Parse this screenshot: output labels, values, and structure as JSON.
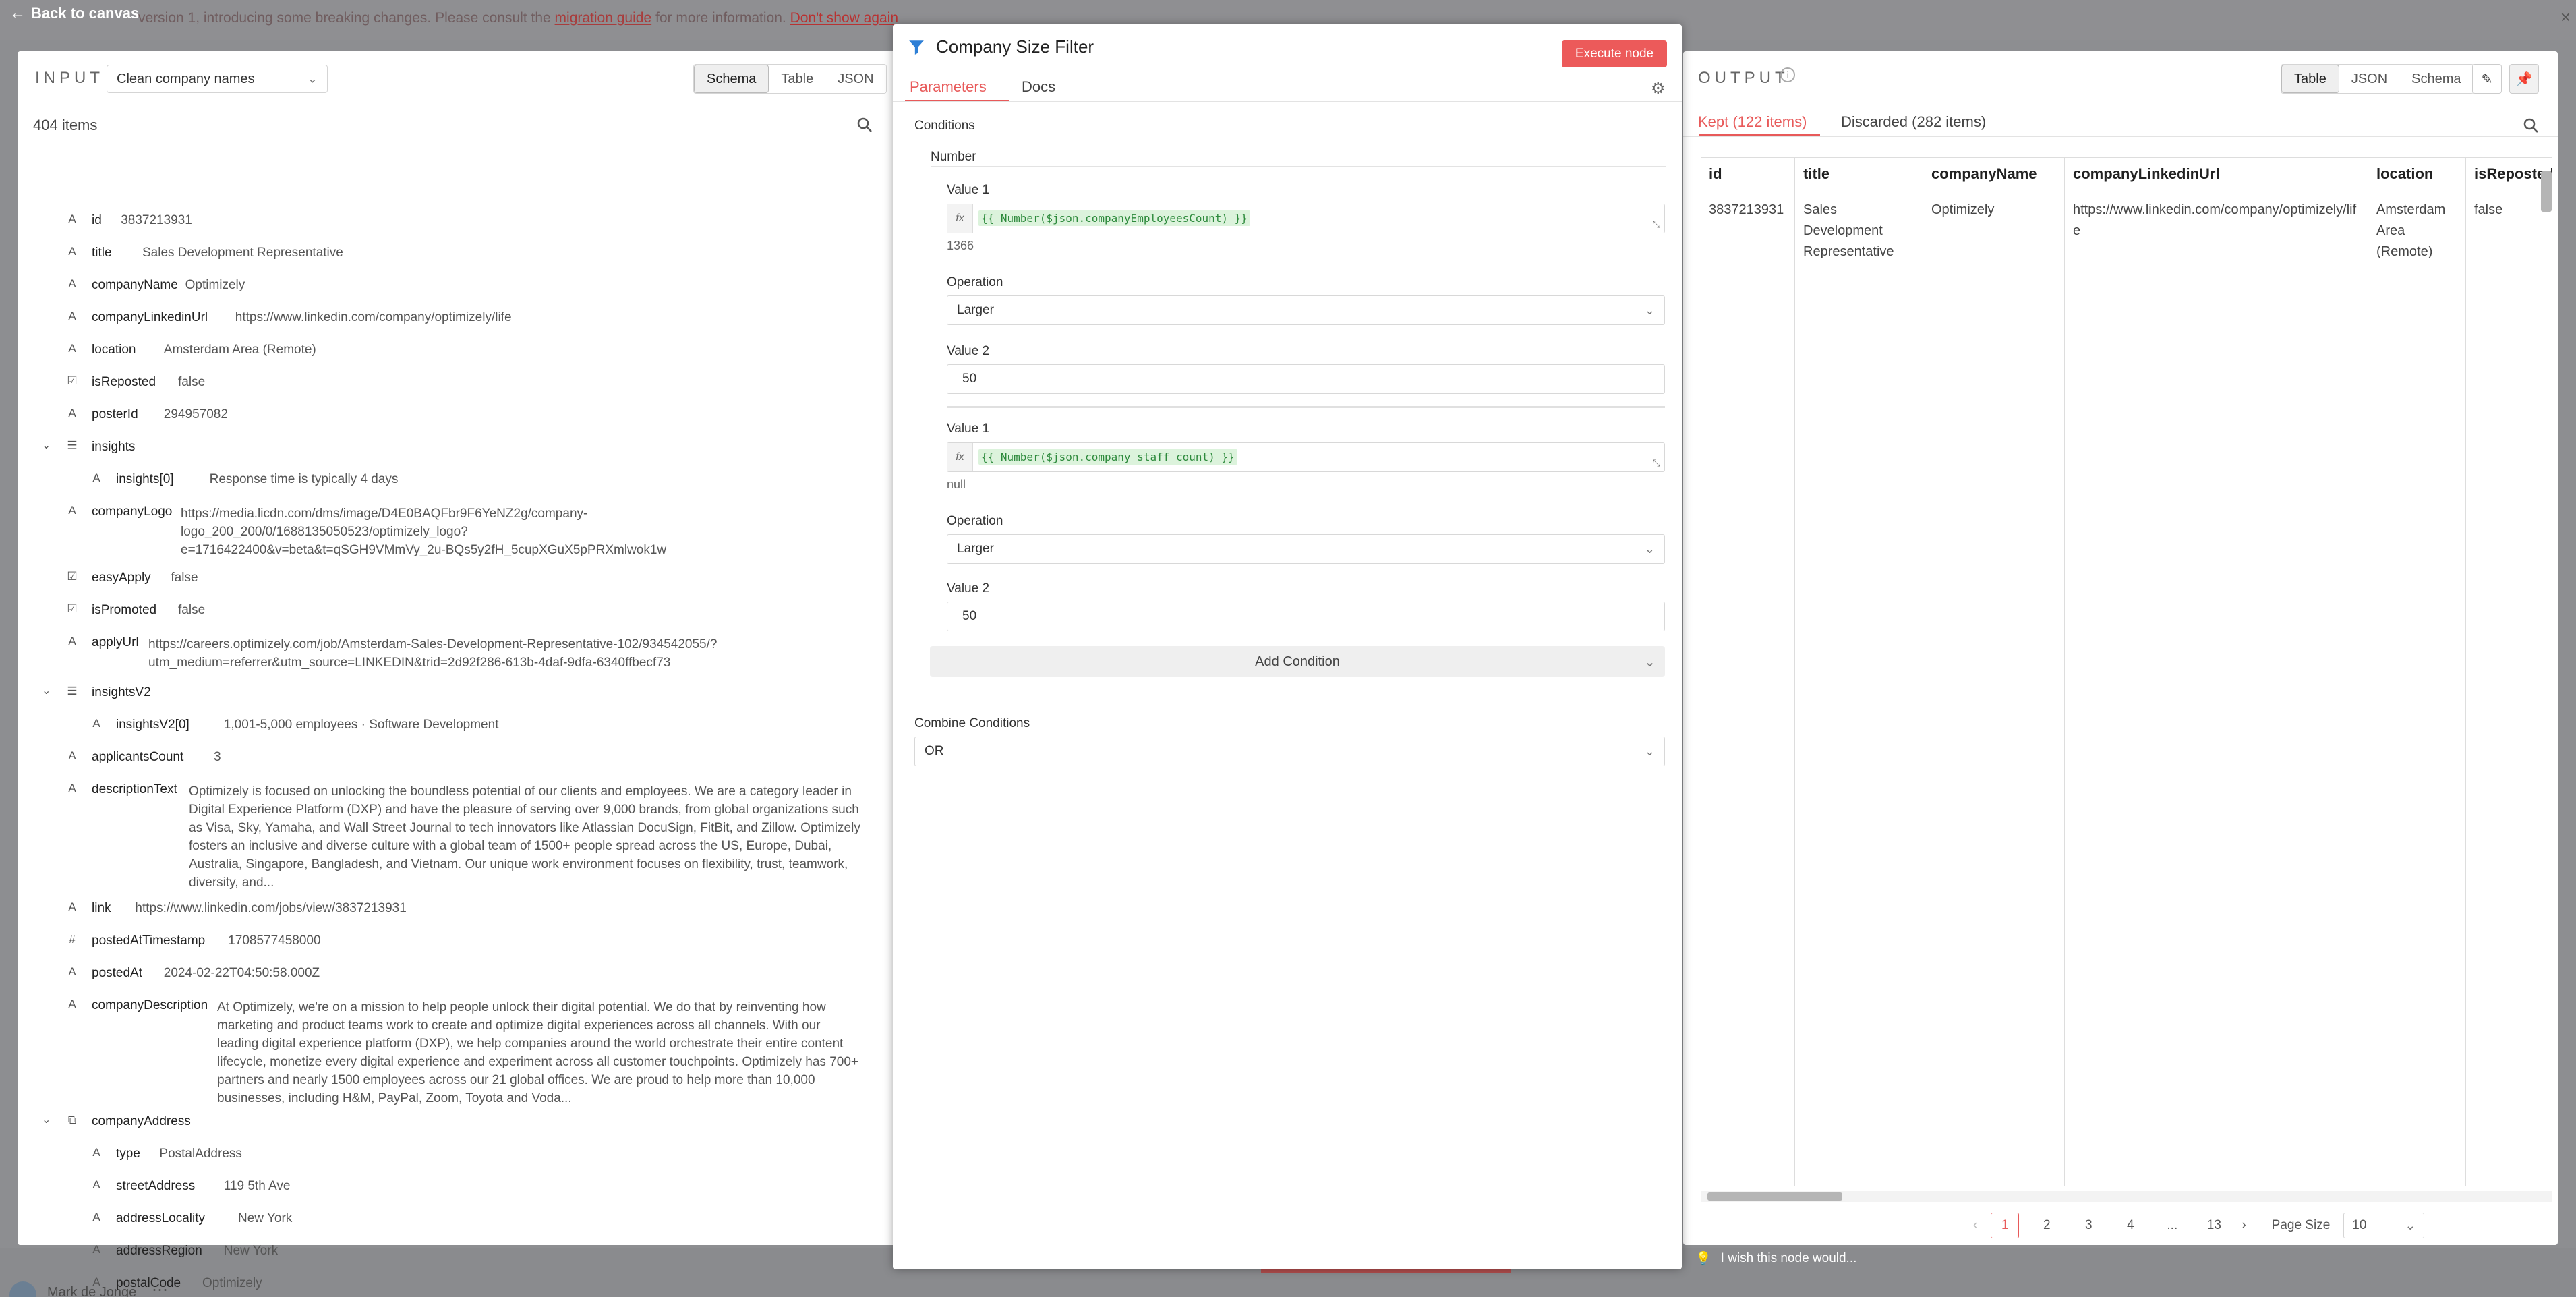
{
  "topbar": {
    "back_label": "Back to canvas",
    "banner_text": "version 1, introducing some breaking changes. Please consult the",
    "banner_link": "migration guide",
    "banner_rest": "for more information.",
    "banner_dismiss": "Don't show again"
  },
  "input": {
    "label": "INPUT",
    "source_node": "Clean company names",
    "view_tabs": [
      "Schema",
      "Table",
      "JSON"
    ],
    "active_view": "Schema",
    "item_count": "404 items",
    "fields": [
      {
        "type": "A",
        "key": "id",
        "value": "3837213931"
      },
      {
        "type": "A",
        "key": "title",
        "value": "Sales Development Representative"
      },
      {
        "type": "A",
        "key": "companyName",
        "value": "Optimizely"
      },
      {
        "type": "A",
        "key": "companyLinkedinUrl",
        "value": "https://www.linkedin.com/company/optimizely/life"
      },
      {
        "type": "A",
        "key": "location",
        "value": "Amsterdam Area (Remote)"
      },
      {
        "type": "bool",
        "key": "isReposted",
        "value": "false"
      },
      {
        "type": "A",
        "key": "posterId",
        "value": "294957082"
      },
      {
        "type": "list",
        "key": "insights",
        "value": ""
      },
      {
        "type": "A",
        "key": "insights[0]",
        "value": "Response time is typically 4 days"
      },
      {
        "type": "A",
        "key": "companyLogo",
        "value": "https://media.licdn.com/dms/image/D4E0BAQFbr9F6YeNZ2g/company-logo_200_200/0/1688135050523/optimizely_logo?e=1716422400&v=beta&t=qSGH9VMmVy_2u-BQs5y2fH_5cupXGuX5pPRXmlwok1w"
      },
      {
        "type": "bool",
        "key": "easyApply",
        "value": "false"
      },
      {
        "type": "bool",
        "key": "isPromoted",
        "value": "false"
      },
      {
        "type": "A",
        "key": "applyUrl",
        "value": "https://careers.optimizely.com/job/Amsterdam-Sales-Development-Representative-102/934542055/?utm_medium=referrer&utm_source=LINKEDIN&trid=2d92f286-613b-4daf-9dfa-6340ffbecf73"
      },
      {
        "type": "list",
        "key": "insightsV2",
        "value": ""
      },
      {
        "type": "A",
        "key": "insightsV2[0]",
        "value": "1,001-5,000 employees · Software Development"
      },
      {
        "type": "A",
        "key": "applicantsCount",
        "value": "3"
      },
      {
        "type": "A",
        "key": "descriptionText",
        "value": "Optimizely is focused on unlocking the boundless potential of our clients and employees. We are a category leader in Digital Experience Platform (DXP) and have the pleasure of serving over 9,000 brands, from global organizations such as Visa, Sky, Yamaha, and Wall Street Journal to tech innovators like Atlassian DocuSign, FitBit, and Zillow. Optimizely fosters an inclusive and diverse culture with a global team of 1500+ people spread across the US, Europe, Dubai, Australia, Singapore, Bangladesh, and Vietnam. Our unique work environment focuses on flexibility, trust, teamwork, diversity, and..."
      },
      {
        "type": "A",
        "key": "link",
        "value": "https://www.linkedin.com/jobs/view/3837213931"
      },
      {
        "type": "#",
        "key": "postedAtTimestamp",
        "value": "1708577458000"
      },
      {
        "type": "A",
        "key": "postedAt",
        "value": "2024-02-22T04:50:58.000Z"
      },
      {
        "type": "A",
        "key": "companyDescription",
        "value": "At Optimizely, we're on a mission to help people unlock their digital potential. We do that by reinventing how marketing and product teams work to create and optimize digital experiences across all channels. With our leading digital experience platform (DXP), we help companies around the world orchestrate their entire content lifecycle, monetize every digital experience and experiment across all customer touchpoints. Optimizely has 700+ partners and nearly 1500 employees across our 21 global offices. We are proud to help more than 10,000 businesses, including H&M, PayPal, Zoom, Toyota and Voda..."
      },
      {
        "type": "obj",
        "key": "companyAddress",
        "value": ""
      },
      {
        "type": "A",
        "key": "type",
        "value": "PostalAddress"
      },
      {
        "type": "A",
        "key": "streetAddress",
        "value": "119 5th Ave"
      },
      {
        "type": "A",
        "key": "addressLocality",
        "value": "New York"
      },
      {
        "type": "A",
        "key": "addressRegion",
        "value": "New York"
      },
      {
        "type": "A",
        "key": "postalCode",
        "value": "Optimizely"
      }
    ]
  },
  "node": {
    "title": "Company Size Filter",
    "execute_label": "Execute node",
    "tabs": [
      "Parameters",
      "Docs"
    ],
    "conditions_label": "Conditions",
    "number_label": "Number",
    "cond1": {
      "value1_label": "Value 1",
      "value1_expr": "{{ Number($json.companyEmployeesCount) }}",
      "value1_result": "1366",
      "operation_label": "Operation",
      "operation": "Larger",
      "value2_label": "Value 2",
      "value2": "50"
    },
    "cond2": {
      "value1_label": "Value 1",
      "value1_expr": "{{ Number($json.company_staff_count) }}",
      "value1_result": "null",
      "operation_label": "Operation",
      "operation": "Larger",
      "value2_label": "Value 2",
      "value2": "50"
    },
    "add_condition_label": "Add Condition",
    "combine_label": "Combine Conditions",
    "combine_value": "OR"
  },
  "output": {
    "label": "OUTPUT",
    "view_tabs": [
      "Table",
      "JSON",
      "Schema"
    ],
    "active_view": "Table",
    "tab_kept": "Kept (122 items)",
    "tab_discarded": "Discarded (282 items)",
    "columns": [
      "id",
      "title",
      "companyName",
      "companyLinkedinUrl",
      "location",
      "isReposted"
    ],
    "row": [
      "3837213931",
      "Sales Development Representative",
      "Optimizely",
      "https://www.linkedin.com/company/optimizely/life",
      "Amsterdam Area (Remote)",
      "false"
    ],
    "pages": [
      "1",
      "2",
      "3",
      "4",
      "...",
      "13"
    ],
    "current_page": "1",
    "page_size_label": "Page Size",
    "page_size": "10",
    "wish_text": "I wish this node would..."
  },
  "footer": {
    "user_name": "Mark de Jonge"
  },
  "colors": {
    "accent": "#ec5a5a",
    "expr_green": "#2d8a3c",
    "expr_bg": "#dcf3dc"
  }
}
